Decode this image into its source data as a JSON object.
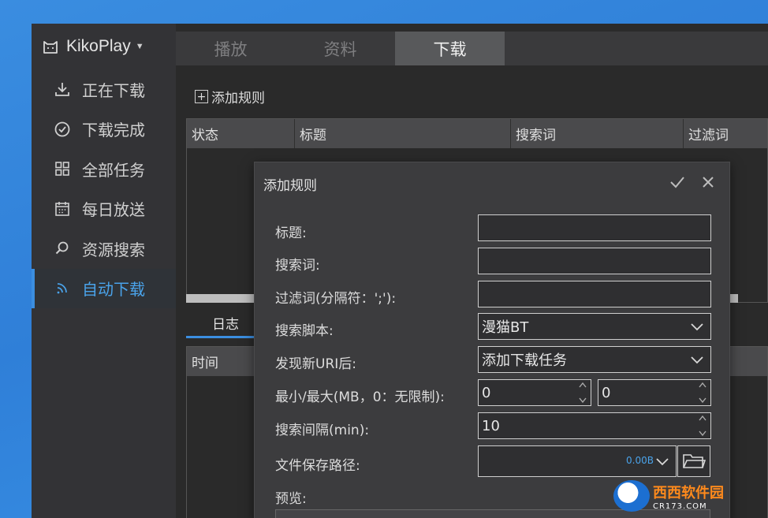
{
  "app": {
    "name": "KikoPlay"
  },
  "sidebar": {
    "items": [
      {
        "label": "正在下载",
        "icon": "download-icon",
        "active": false
      },
      {
        "label": "下载完成",
        "icon": "check-circle-icon",
        "active": false
      },
      {
        "label": "全部任务",
        "icon": "grid-icon",
        "active": false
      },
      {
        "label": "每日放送",
        "icon": "calendar-icon",
        "active": false
      },
      {
        "label": "资源搜索",
        "icon": "search-icon",
        "active": false
      },
      {
        "label": "自动下载",
        "icon": "rss-icon",
        "active": true
      }
    ]
  },
  "tabs": [
    {
      "label": "播放",
      "active": false
    },
    {
      "label": "资料",
      "active": false
    },
    {
      "label": "下载",
      "active": true
    }
  ],
  "toolbar": {
    "add_rule_label": "添加规则"
  },
  "rule_table": {
    "columns": [
      "状态",
      "标题",
      "搜索词",
      "过滤词"
    ]
  },
  "log": {
    "tab_label": "日志",
    "columns": [
      "时间"
    ]
  },
  "dialog": {
    "title": "添加规则",
    "fields": {
      "title_label": "标题:",
      "title_value": "",
      "search_label": "搜索词:",
      "search_value": "",
      "filter_label": "过滤词(分隔符：';'):",
      "filter_value": "",
      "script_label": "搜索脚本:",
      "script_value": "漫猫BT",
      "action_label": "发现新URI后:",
      "action_value": "添加下载任务",
      "size_label": "最小/最大(MB，0：无限制):",
      "size_min": "0",
      "size_max": "0",
      "interval_label": "搜索间隔(min):",
      "interval_value": "10",
      "path_label": "文件保存路径:",
      "path_size": "0.00B",
      "preview_label": "预览:"
    }
  },
  "watermark": {
    "brand": "西西软件园",
    "site": "CR173.COM"
  },
  "colors": {
    "accent": "#3b8ee0",
    "active_text": "#4aa3ea",
    "sidebar_bg": "#333336",
    "dialog_bg": "#3c3c3e"
  }
}
